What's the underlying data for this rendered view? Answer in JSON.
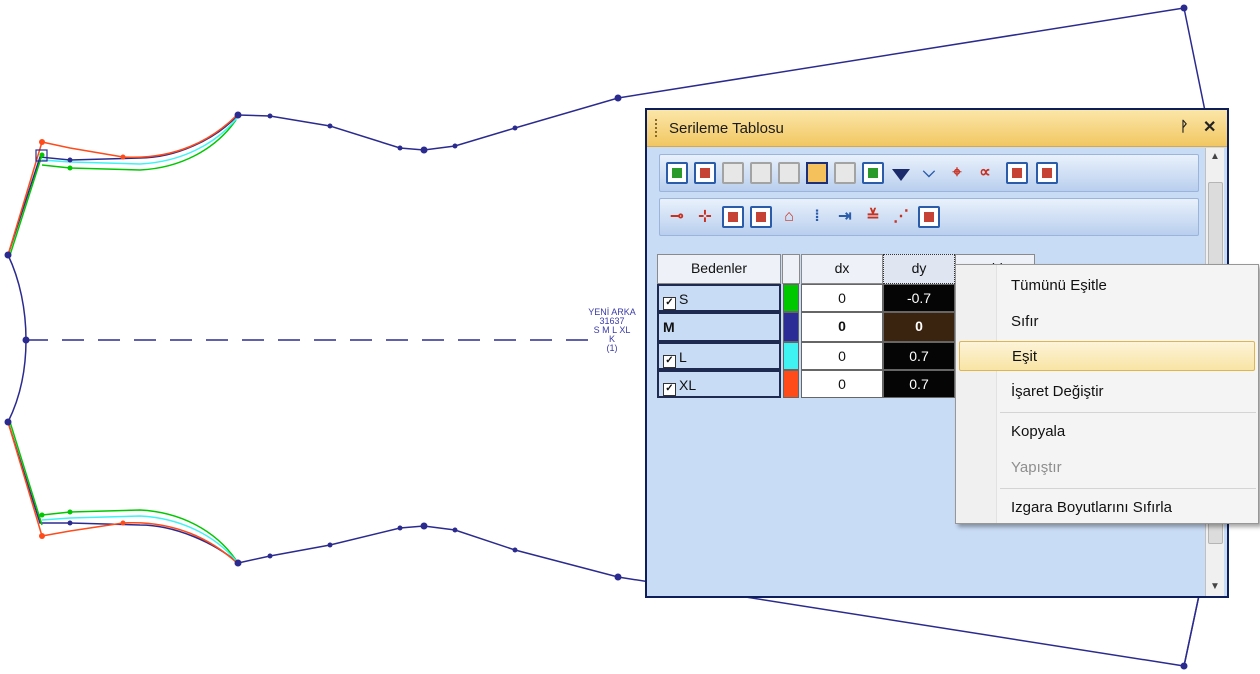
{
  "pattern": {
    "label_lines": [
      "YENİ ARKA",
      "31637",
      "S M L XL",
      "K",
      "(1)"
    ]
  },
  "panel": {
    "title": "Serileme Tablosu",
    "pin_glyph": "4",
    "close_glyph": "✕"
  },
  "toolbar1": {
    "icons": [
      "move-left-icon",
      "copy-piece-icon",
      "mirror-icon",
      "x-axis-icon",
      "y-axis-icon",
      "dxdy-icon",
      "dd-icon",
      "move-right-icon",
      "dropdown-arrow-icon",
      "angle-icon",
      "ruler-scale-icon",
      "curve-icon",
      "dot-icon",
      "window-icon"
    ]
  },
  "toolbar2": {
    "icons": [
      "add-point-icon",
      "insert-point-icon",
      "angle-grade-icon",
      "rotate-grade-icon",
      "symmetry-icon",
      "vertical-align-icon",
      "horizontal-align-icon",
      "distribute-icon",
      "slope-icon",
      "checkbox-icon"
    ]
  },
  "grid": {
    "headers": {
      "name": "Bedenler",
      "color": "",
      "dx": "dx",
      "dy": "dy",
      "dd": "dd",
      "extra": "(...)"
    },
    "rows": [
      {
        "name": "S",
        "checked": true,
        "color": "#00c800",
        "dx": "0",
        "dy": "-0.7"
      },
      {
        "name": "M",
        "checked": false,
        "color": "#2c2c96",
        "dx": "0",
        "dy": "0"
      },
      {
        "name": "L",
        "checked": true,
        "color": "#3ff3f3",
        "dx": "0",
        "dy": "0.7"
      },
      {
        "name": "XL",
        "checked": true,
        "color": "#ff4a1a",
        "dx": "0",
        "dy": "0.7"
      }
    ]
  },
  "context_menu": {
    "items": [
      {
        "label": "Tümünü Eşitle",
        "state": "normal"
      },
      {
        "label": "Sıfır",
        "state": "normal"
      },
      {
        "label": "Eşit",
        "state": "highlighted"
      },
      {
        "label": "İşaret Değiştir",
        "state": "normal"
      },
      {
        "label": "Kopyala",
        "state": "normal"
      },
      {
        "label": "Yapıştır",
        "state": "disabled"
      },
      {
        "label": "Izgara Boyutlarını Sıfırla",
        "state": "normal"
      }
    ]
  },
  "colors": {
    "outline": "#2b2b8f",
    "size_s": "#00c800",
    "size_l": "#3ff3f3",
    "size_xl": "#ff4a1a",
    "highlight": "#f8e4a4"
  }
}
